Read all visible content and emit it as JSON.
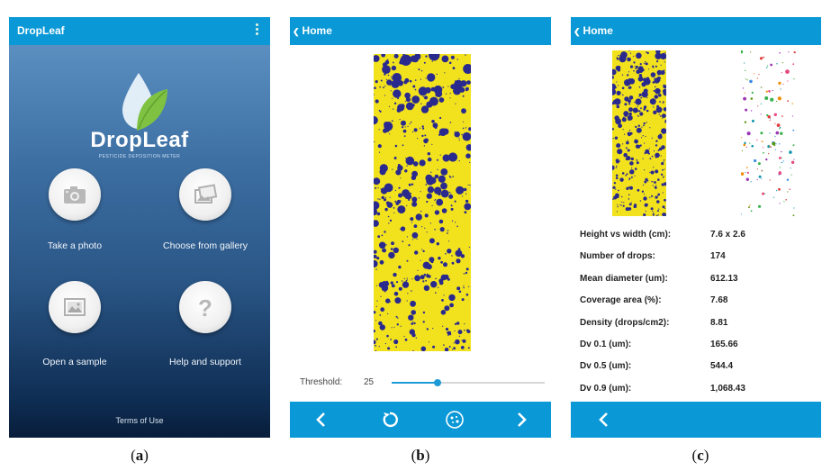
{
  "screen_a": {
    "app_title": "DropLeaf",
    "brand_name": "DropLeaf",
    "tagline": "PESTICIDE DEPOSITION METER",
    "buttons": [
      {
        "label": "Take a photo",
        "icon": "camera-icon"
      },
      {
        "label": "Choose from gallery",
        "icon": "gallery-icon"
      },
      {
        "label": "Open a sample",
        "icon": "image-icon"
      },
      {
        "label": "Help and support",
        "icon": "question-icon"
      }
    ],
    "terms": "Terms of Use"
  },
  "screen_b": {
    "back_label": "Home",
    "threshold_label": "Threshold:",
    "threshold_value": "25",
    "threshold_fraction": 0.3,
    "bottom_nav": [
      "chevron-left-icon",
      "rotate-icon",
      "process-icon",
      "chevron-right-icon"
    ]
  },
  "screen_c": {
    "back_label": "Home",
    "stats": [
      {
        "label": "Height vs width (cm):",
        "value": "7.6 x 2.6"
      },
      {
        "label": "Number of drops:",
        "value": "174"
      },
      {
        "label": "Mean diameter (um):",
        "value": "612.13"
      },
      {
        "label": "Coverage area (%):",
        "value": "7.68"
      },
      {
        "label": "Density (drops/cm2):",
        "value": "8.81"
      },
      {
        "label": "Dv 0.1 (um):",
        "value": "165.66"
      },
      {
        "label": "Dv 0.5 (um):",
        "value": "544.4"
      },
      {
        "label": "Dv 0.9 (um):",
        "value": "1,068.43"
      }
    ]
  },
  "captions": [
    "a",
    "b",
    "c"
  ],
  "colors": {
    "appbar": "#0a98d6",
    "strip": "#f2e21e",
    "drop": "#2a2a8e"
  }
}
